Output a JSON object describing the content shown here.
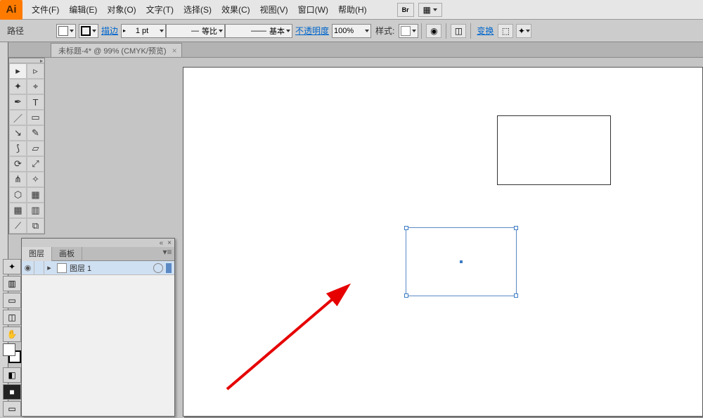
{
  "app": {
    "logo": "Ai"
  },
  "menu": {
    "file": "文件(F)",
    "edit": "编辑(E)",
    "object": "对象(O)",
    "type": "文字(T)",
    "select": "选择(S)",
    "effect": "效果(C)",
    "view": "视图(V)",
    "window": "窗口(W)",
    "help": "帮助(H)"
  },
  "control": {
    "mode": "路径",
    "stroke_label": "描边",
    "stroke_weight": "1 pt",
    "uniform": "等比",
    "basic": "基本",
    "opacity_label": "不透明度",
    "opacity_value": "100%",
    "style_label": "样式:",
    "transform": "变换"
  },
  "doc_tab": {
    "title": "未标题-4* @ 99% (CMYK/预览)"
  },
  "layers_panel": {
    "tab_layers": "图层",
    "tab_artboards": "画板",
    "layer1_name": "图层 1"
  },
  "tools": {
    "selection": "▸",
    "direct": "▹",
    "wand": "✦",
    "lasso": "⌖",
    "pen": "✒",
    "type": "T",
    "line": "／",
    "rect": "▭",
    "brush": "↘",
    "pencil": "✎",
    "blob": "⟆",
    "eraser": "▱",
    "rotate": "⟳",
    "scale": "⤢",
    "width": "⋔",
    "free": "✧",
    "shape": "⬡",
    "persp": "▦",
    "mesh": "▦",
    "gradient": "▥",
    "eyedrop": "⟋",
    "blend": "⧉",
    "dark": "■"
  }
}
